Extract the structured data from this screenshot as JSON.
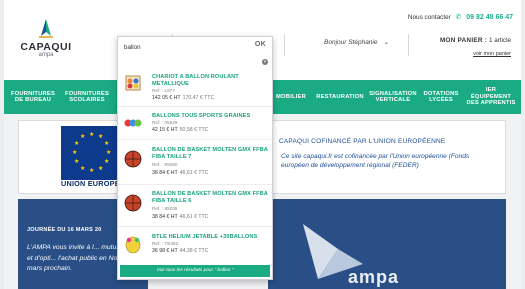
{
  "header": {
    "logo_text": "CAPAQUI",
    "logo_sub": "ampa",
    "contact_label": "Nous contacter",
    "phone": "09 82 48 66 47",
    "greeting": "Bonjour Stéphanie",
    "cart_label": "MON PANIER :",
    "cart_count": "1 article",
    "cart_link": "voir mon panier"
  },
  "nav": {
    "items": [
      "FOURNITURES DE BUREAU",
      "FOURNITURES SCOLAIRES",
      "MOBILIER",
      "RESTAURATION",
      "SIGNALISATION VERTICALE",
      "DOTATIONS LYCÉES",
      "ÉQUIPEMENT DES APPRENTIS"
    ],
    "item8_prefix": "IER"
  },
  "eu": {
    "caption": "UNION EUROPE",
    "title": "CAPAQUI COFINANCÉ PAR L'UNION EUROPÉENNE",
    "text": "Ce site capaqui.fr est cofinancée par l'Union européenne (Fonds européen de développement régional (FEDER)"
  },
  "news": {
    "date": "JOURNÉE DU 16 MARS 20",
    "text": "L'AMPA vous invite à l... mutualisation et d'opti... l'achat public en Nouv... le 16 mars prochain."
  },
  "promo": {
    "text": "ampa"
  },
  "search": {
    "query": "ballon",
    "ok_label": "OK",
    "clear_label": "×",
    "results": [
      {
        "title": "CHARIOT A BALLON ROULANT METALLIQUE",
        "ref": "Ref. : L977",
        "price": "142 05 € HT",
        "old_price": "170,47 € TTC"
      },
      {
        "title": "BALLONS TOUS SPORTS GRAINES",
        "ref": "Ref. : 05629",
        "price": "42 15 € HT",
        "old_price": "50,58 € TTC"
      },
      {
        "title": "BALLON DE BASKET MOLTEN GMX FFBA FIBA TAILLE 7",
        "ref": "Ref. : 85050",
        "price": "38 84 € HT",
        "old_price": "46,61 € TTC"
      },
      {
        "title": "BALLON DE BASKET MOLTEN GMX FFBA FIBA TAILLE 6",
        "ref": "Ref. : 85035",
        "price": "38 84 € HT",
        "old_price": "46,61 € TTC"
      },
      {
        "title": "BTLE HELIUM JETABLE +30BALLONS",
        "ref": "Ref. : TB482",
        "price": "36 98 € HT",
        "old_price": "44,38 € TTC"
      }
    ],
    "see_all": "Voir tous les résultats pour \" ballon \""
  }
}
